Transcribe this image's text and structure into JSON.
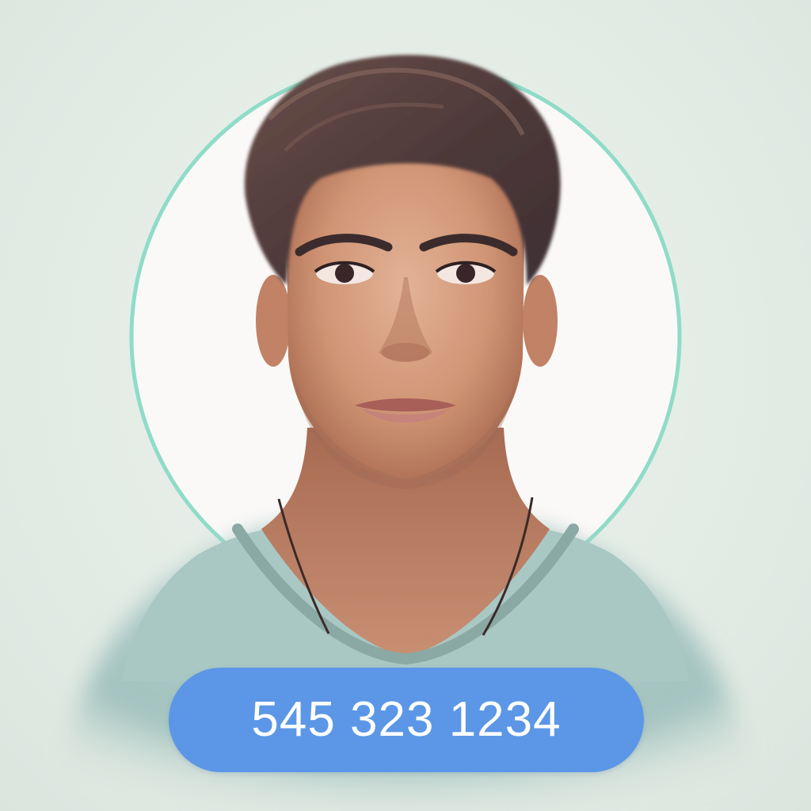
{
  "contact_card": {
    "phone_number": "545 323 1234",
    "avatar_icon": "person-portrait-icon"
  },
  "colors": {
    "background": "#e2ebe5",
    "avatar_ring": "#8fdcc8",
    "avatar_fill": "#fbf9f8",
    "pill": "#5b97e6",
    "pill_text": "#ffffff",
    "shirt": "#a8c6c2",
    "skin": "#c98f6e",
    "hair": "#5a4340"
  }
}
